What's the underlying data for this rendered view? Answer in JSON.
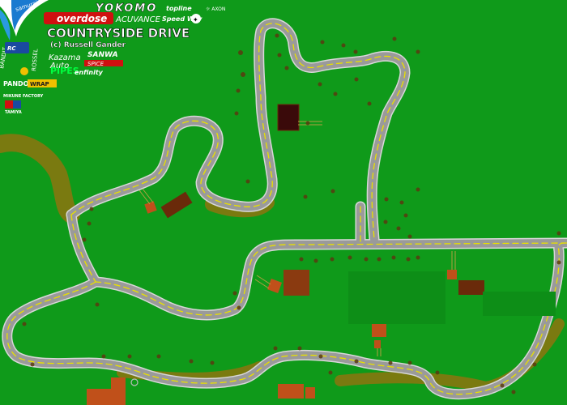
{
  "track": {
    "title": "COUNTRYSIDE DRIVE",
    "author": "(c) Russell Gander"
  },
  "sponsors": {
    "yokomo": "YOKOMO",
    "overdose": "overdose",
    "acuvance": "ACUVANCE",
    "speedway": "Speed Way",
    "sanwa": "SANWA",
    "kazama": "Kazama",
    "pipes": "PIPES",
    "enfinity": "enfinity",
    "pandora": "PANDORA",
    "mikune": "MIKUNE FACTORY",
    "tamiya": "TAMIYA",
    "samurai": "samurai"
  },
  "colors": {
    "grass": "#0f9a1a",
    "road": "#9a9a9a",
    "road_edge": "#d8d8d8",
    "center_line": "#e8e000",
    "dirt": "#7a7a10",
    "building_orange": "#c0501a",
    "building_brown": "#6a2a0a",
    "tree": "#5a3a10"
  }
}
